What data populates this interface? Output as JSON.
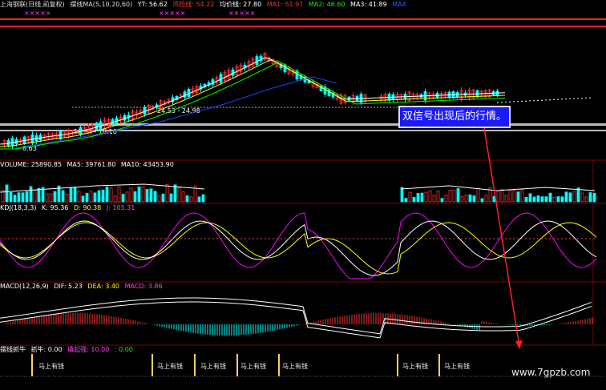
{
  "main": {
    "title": "上海钢联(日线,前复权)",
    "ma_label": "摆线MA(5,10,20,60)",
    "yt": "YT: 56.62",
    "fx": "风险线: 54.22",
    "avg": "均价线: 27.80",
    "ma1": "MA1: 51.97",
    "ma2": "MA2: 46.60",
    "ma3": "MA3: 41.89",
    "ma4": "MA4",
    "marks": "×××××",
    "price_low": "8.63",
    "range1": "18.94 - 18.10",
    "range2": "24.53 - 24.98"
  },
  "volume": {
    "label": "VOLUME: 25890.85",
    "ma5": "MA5: 39761.80",
    "ma10": "MA10: 43453.90"
  },
  "kdj": {
    "label": "KDJ(18,3,3)",
    "k": "K: 95.36",
    "d": "D: 90.38",
    "j": "J: 105.31"
  },
  "macd": {
    "label": "MACD(12,26,9)",
    "dif": "DIF: 5.23",
    "dea": "DEA: 3.40",
    "macd": "MACD: 3.86"
  },
  "signal_panel": {
    "label": "摆线抓牛",
    "zhuaniu": "抓牛: 0.00",
    "juli": "撬起强: 10.00",
    "val": ": 0.00",
    "signal_text": "马上有钱"
  },
  "callout": "双信号出现后的行情。",
  "watermark": "www.7gpzb.com",
  "colors": {
    "up": "#ff3030",
    "down": "#00ffff",
    "ma_white": "#ffffff",
    "ma_yellow": "#ffff00",
    "ma_purple": "#ff00ff",
    "ma_green": "#00ff00",
    "ma_blue": "#2040ff",
    "grid": "#800000"
  }
}
